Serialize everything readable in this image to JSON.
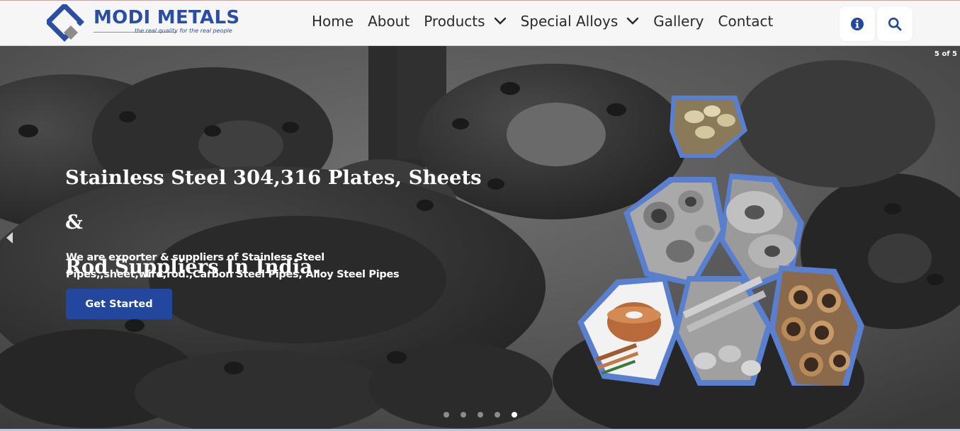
{
  "brand": {
    "name": "MODI METALS",
    "tagline": "the real quality for the real people",
    "color": "#2b4ea2"
  },
  "nav": {
    "items": [
      {
        "label": "Home",
        "dropdown": false
      },
      {
        "label": "About",
        "dropdown": false
      },
      {
        "label": "Products",
        "dropdown": true
      },
      {
        "label": "Special Alloys",
        "dropdown": true
      },
      {
        "label": "Gallery",
        "dropdown": false
      },
      {
        "label": "Contact",
        "dropdown": false
      }
    ],
    "icons": [
      "info-icon",
      "search-icon"
    ]
  },
  "hero": {
    "slide_counter": "5 of 5",
    "title_line1": "Stainless Steel 304,316 Plates, Sheets &",
    "title_line2": "Rod Suppliers In India.",
    "subtitle_line1": "We are exporter & suppliers of Stainless Steel",
    "subtitle_line2": "Pipes,,sheet,wire,rod.,Carbon Steel Pipes, Alloy Steel Pipes",
    "cta_label": "Get Started",
    "total_slides": 5,
    "active_slide": 5,
    "button_color": "#23479c",
    "hex_frame_color": "#5a7fcf"
  }
}
